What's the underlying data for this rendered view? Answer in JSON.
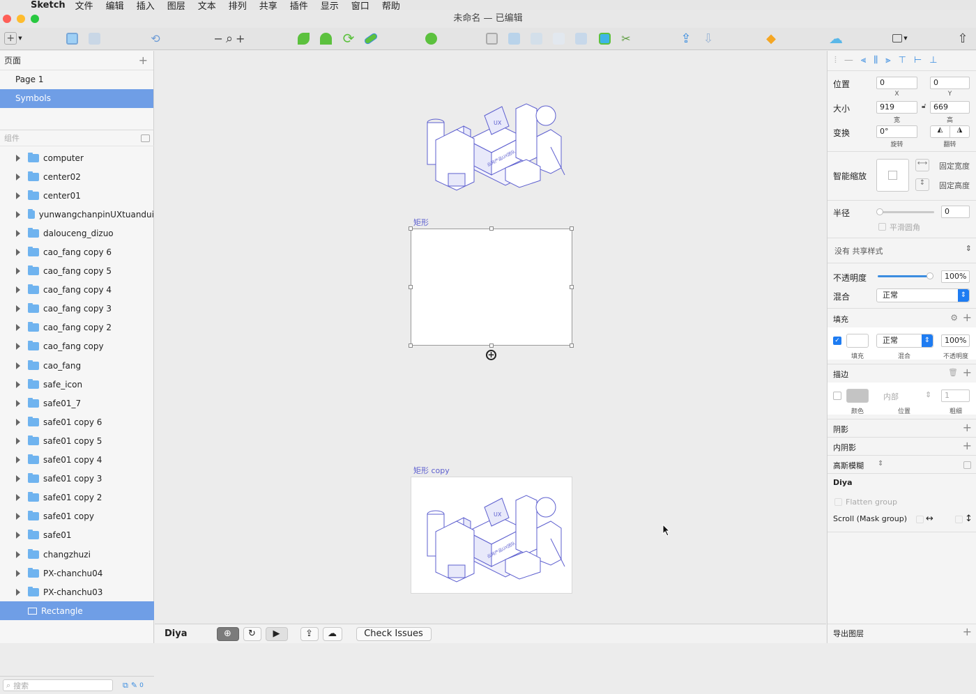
{
  "menubar": {
    "app": "Sketch",
    "items": [
      "文件",
      "编辑",
      "插入",
      "图层",
      "文本",
      "排列",
      "共享",
      "插件",
      "显示",
      "窗口",
      "帮助"
    ]
  },
  "window": {
    "title": "未命名 — 已编辑"
  },
  "pages": {
    "header": "页面",
    "items": [
      "Page 1",
      "Symbols"
    ],
    "selected": 1
  },
  "components": {
    "placeholder": "组件"
  },
  "layers": [
    "computer",
    "center02",
    "center01",
    "yunwangchanpinUXtuandui",
    "dalouceng_dizuo",
    "cao_fang copy 6",
    "cao_fang copy 5",
    "cao_fang copy 4",
    "cao_fang copy 3",
    "cao_fang copy 2",
    "cao_fang copy",
    "cao_fang",
    "safe_icon",
    "safe01_7",
    "safe01 copy 6",
    "safe01 copy 5",
    "safe01 copy 4",
    "safe01 copy 3",
    "safe01 copy 2",
    "safe01 copy",
    "safe01",
    "changzhuzi",
    "PX-chanchu04",
    "PX-chanchu03"
  ],
  "selected_layer": "Rectangle",
  "search": {
    "placeholder": "搜索",
    "count": "0"
  },
  "canvas": {
    "label1": "矩形",
    "label2": "矩形 copy"
  },
  "illustration": {
    "badge": "UX",
    "sign": "云网产品UX团队"
  },
  "bottombar": {
    "plugin": "Diya",
    "check": "Check Issues"
  },
  "inspector": {
    "position_label": "位置",
    "x": "0",
    "y": "0",
    "x_sub": "X",
    "y_sub": "Y",
    "size_label": "大小",
    "w": "919",
    "h": "669",
    "w_sub": "宽",
    "h_sub": "高",
    "transform_label": "变换",
    "rotate": "0°",
    "rotate_sub": "旋转",
    "flip_sub": "翻转",
    "resize_label": "智能缩放",
    "fix_width": "固定宽度",
    "fix_height": "固定高度",
    "radius_label": "半径",
    "radius": "0",
    "smooth": "平滑圆角",
    "shared_style": "没有 共享样式",
    "opacity_label": "不透明度",
    "opacity": "100%",
    "blend_label": "混合",
    "blend": "正常",
    "fill_label": "填充",
    "fill_blend": "正常",
    "fill_opacity": "100%",
    "fill_sub": "填充",
    "fill_blend_sub": "混合",
    "fill_opacity_sub": "不透明度",
    "border_label": "描边",
    "border_pos": "内部",
    "border_width": "1",
    "border_color_sub": "颜色",
    "border_pos_sub": "位置",
    "border_width_sub": "粗细",
    "shadow": "阴影",
    "inner_shadow": "内阴影",
    "blur": "高斯模糊",
    "diya": "Diya",
    "flatten": "Flatten group",
    "scroll": "Scroll (Mask group)",
    "export": "导出图层"
  },
  "colors": {
    "selection": "#6f9ee6",
    "folder": "#6fb3ef",
    "accent": "#1e7cf2",
    "artboard_label": "#5d5fcf"
  }
}
